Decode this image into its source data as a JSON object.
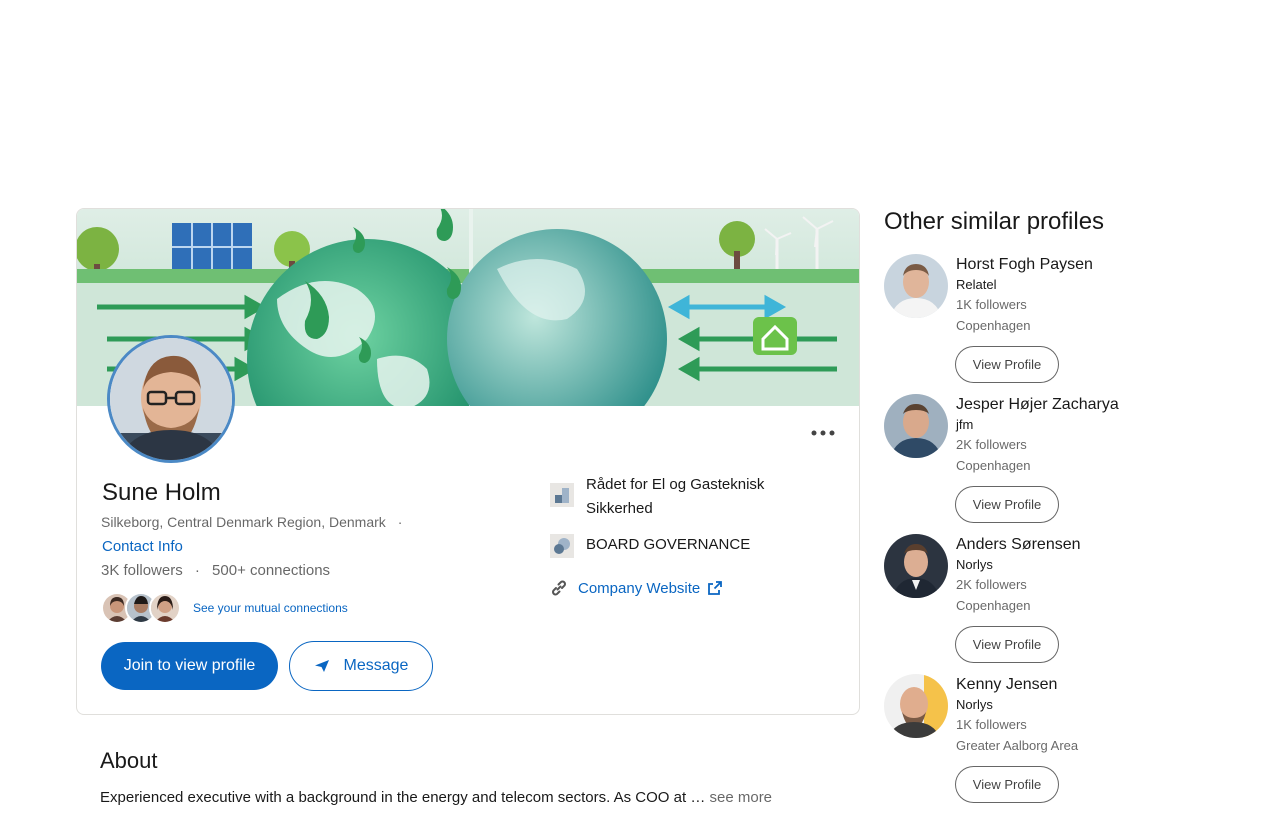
{
  "profile": {
    "name": "Sune Holm",
    "location": "Silkeborg, Central Denmark Region, Denmark",
    "location_sep": "·",
    "contact_info": "Contact Info",
    "followers": "3K followers",
    "stats_sep": "·",
    "connections": "500+ connections",
    "mutual_link": "See your mutual connections",
    "join_label": "Join to view profile",
    "message_label": "Message"
  },
  "organizations": [
    {
      "name": "Rådet for El og Gasteknisk Sikkerhed"
    },
    {
      "name": "BOARD GOVERNANCE"
    }
  ],
  "website_label": "Company Website",
  "about": {
    "title": "About",
    "text": "Experienced executive with a background in the energy and telecom sectors. As COO at",
    "ellipsis": "…",
    "see_more": "see more"
  },
  "sidebar": {
    "title": "Other similar profiles",
    "view_label": "View Profile",
    "profiles": [
      {
        "name": "Horst Fogh Paysen",
        "company": "Relatel",
        "followers": "1K followers",
        "location": "Copenhagen"
      },
      {
        "name": "Jesper Højer Zacharya",
        "company": "jfm",
        "followers": "2K followers",
        "location": "Copenhagen"
      },
      {
        "name": "Anders Sørensen",
        "company": "Norlys",
        "followers": "2K followers",
        "location": "Copenhagen"
      },
      {
        "name": "Kenny Jensen",
        "company": "Norlys",
        "followers": "1K followers",
        "location": "Greater Aalborg Area"
      }
    ]
  },
  "colors": {
    "accent": "#0a66c2",
    "border": "#e0dfdc"
  }
}
